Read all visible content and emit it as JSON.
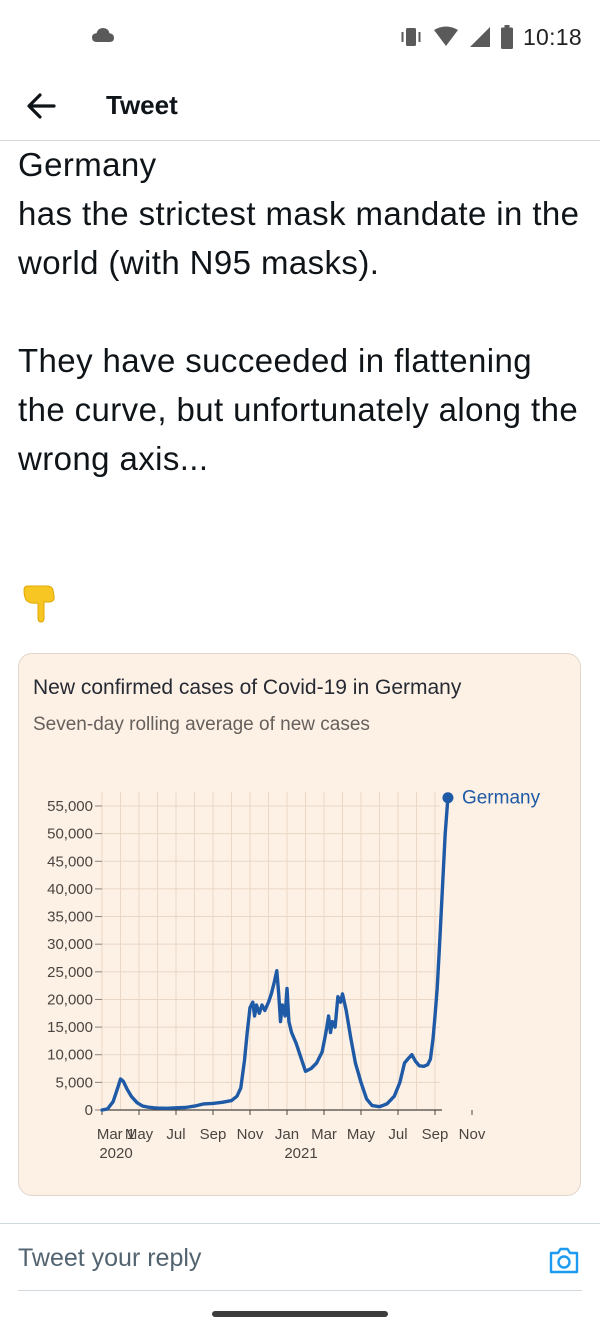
{
  "status_bar": {
    "time": "10:18",
    "icons": [
      "cloud-icon",
      "vibrate-icon",
      "wifi-icon",
      "signal-icon",
      "battery-icon"
    ]
  },
  "header": {
    "title": "Tweet",
    "back_icon": "arrow-left-icon"
  },
  "tweet": {
    "paragraph_1_before_flag": "Germany",
    "flag_icon": "germany-flag-emoji",
    "paragraph_1_after_flag": "has the strictest mask mandate in the world (with N95 masks).",
    "paragraph_2": "They have succeeded in flattening the curve, but unfortunately along the wrong axis...",
    "emoji_icon": "pointing-down-hand-emoji"
  },
  "chart_card": {
    "background": "#fdf1e6",
    "chart_data": {
      "type": "line",
      "title": "New confirmed cases of Covid-19 in Germany",
      "subtitle": "Seven-day rolling average of new cases",
      "ylabel": "",
      "xlabel": "",
      "ylim": [
        0,
        55000
      ],
      "y_ticks": [
        0,
        5000,
        10000,
        15000,
        20000,
        25000,
        30000,
        35000,
        40000,
        45000,
        50000,
        55000
      ],
      "y_tick_labels": [
        "0",
        "5,000",
        "10,000",
        "15,000",
        "20,000",
        "25,000",
        "30,000",
        "35,000",
        "40,000",
        "45,000",
        "50,000",
        "55,000"
      ],
      "x_tick_labels": [
        "Mar 1",
        "May",
        "Jul",
        "Sep",
        "Nov",
        "Jan",
        "Mar",
        "May",
        "Jul",
        "Sep",
        "Nov"
      ],
      "x_year_labels": [
        {
          "label": "2020",
          "at_month": 0
        },
        {
          "label": "2021",
          "at_month": 10
        }
      ],
      "grid": true,
      "legend_placement": "end-of-line",
      "series": [
        {
          "name": "Germany",
          "color": "#1f5aa6",
          "points": [
            [
              0.0,
              0
            ],
            [
              0.3,
              200
            ],
            [
              0.6,
              1500
            ],
            [
              0.85,
              4000
            ],
            [
              1.0,
              5600
            ],
            [
              1.15,
              5200
            ],
            [
              1.35,
              3800
            ],
            [
              1.6,
              2400
            ],
            [
              1.9,
              1300
            ],
            [
              2.2,
              700
            ],
            [
              2.5,
              500
            ],
            [
              2.8,
              400
            ],
            [
              3.0,
              350
            ],
            [
              3.5,
              300
            ],
            [
              4.0,
              400
            ],
            [
              4.5,
              450
            ],
            [
              5.0,
              700
            ],
            [
              5.5,
              1100
            ],
            [
              6.0,
              1200
            ],
            [
              6.5,
              1400
            ],
            [
              7.0,
              1700
            ],
            [
              7.3,
              2500
            ],
            [
              7.5,
              4000
            ],
            [
              7.7,
              9000
            ],
            [
              7.85,
              14000
            ],
            [
              8.0,
              18500
            ],
            [
              8.15,
              19500
            ],
            [
              8.25,
              17000
            ],
            [
              8.35,
              19000
            ],
            [
              8.5,
              17500
            ],
            [
              8.65,
              19000
            ],
            [
              8.8,
              18000
            ],
            [
              9.0,
              19500
            ],
            [
              9.15,
              21000
            ],
            [
              9.3,
              23000
            ],
            [
              9.45,
              25200
            ],
            [
              9.55,
              21000
            ],
            [
              9.65,
              16000
            ],
            [
              9.75,
              19000
            ],
            [
              9.9,
              17000
            ],
            [
              10.0,
              22000
            ],
            [
              10.1,
              16000
            ],
            [
              10.25,
              14000
            ],
            [
              10.5,
              12000
            ],
            [
              10.8,
              9000
            ],
            [
              11.0,
              7000
            ],
            [
              11.3,
              7500
            ],
            [
              11.6,
              8500
            ],
            [
              11.9,
              10500
            ],
            [
              12.1,
              14000
            ],
            [
              12.25,
              17000
            ],
            [
              12.35,
              14000
            ],
            [
              12.45,
              16000
            ],
            [
              12.6,
              15000
            ],
            [
              12.75,
              20500
            ],
            [
              12.9,
              19500
            ],
            [
              13.0,
              21000
            ],
            [
              13.2,
              18000
            ],
            [
              13.45,
              13000
            ],
            [
              13.7,
              8500
            ],
            [
              14.0,
              5000
            ],
            [
              14.3,
              2000
            ],
            [
              14.6,
              800
            ],
            [
              15.0,
              600
            ],
            [
              15.4,
              1100
            ],
            [
              15.8,
              2500
            ],
            [
              16.1,
              5000
            ],
            [
              16.35,
              8500
            ],
            [
              16.55,
              9300
            ],
            [
              16.75,
              10000
            ],
            [
              16.95,
              8800
            ],
            [
              17.15,
              8000
            ],
            [
              17.4,
              7900
            ],
            [
              17.6,
              8200
            ],
            [
              17.75,
              9200
            ],
            [
              17.9,
              13000
            ],
            [
              18.0,
              17000
            ],
            [
              18.12,
              22000
            ],
            [
              18.25,
              30000
            ],
            [
              18.4,
              40000
            ],
            [
              18.55,
              50000
            ],
            [
              18.7,
              56500
            ]
          ]
        }
      ]
    }
  },
  "reply": {
    "placeholder": "Tweet your reply",
    "camera_icon": "camera-icon"
  }
}
